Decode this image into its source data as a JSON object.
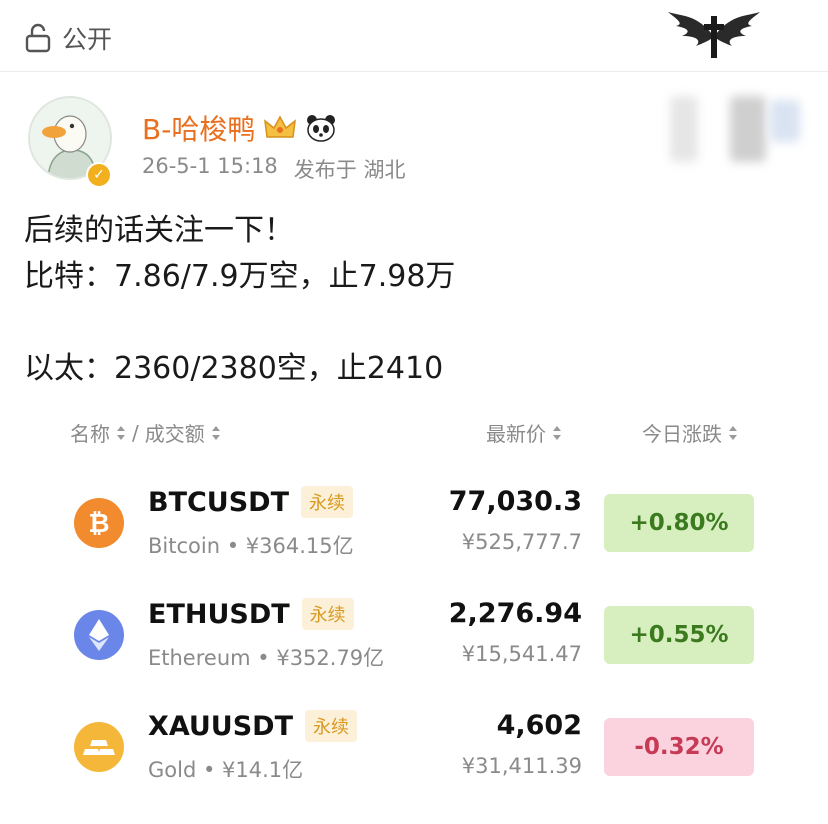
{
  "topbar": {
    "privacy_label": "公开"
  },
  "post": {
    "author": "B-哈梭鸭",
    "date": "26-5-1 15:18",
    "location": "发布于 湖北",
    "text": "后续的话关注一下！\n比特：7.86/7.9万空，止7.98万\n\n以太：2360/2380空，止2410"
  },
  "market": {
    "col_name": "名称",
    "col_separator": "/",
    "col_volume": "成交额",
    "col_price": "最新价",
    "col_change": "今日涨跌",
    "perp_label": "永续",
    "rows": [
      {
        "symbol": "BTCUSDT",
        "sub": "Bitcoin • ¥364.15亿",
        "price": "77,030.3",
        "cny": "¥525,777.7",
        "change": "+0.80%",
        "icon": "bitcoin-icon",
        "icon_color": "#f28a2e",
        "change_color": "#3b7a1f",
        "change_bg": "#d7efbf"
      },
      {
        "symbol": "ETHUSDT",
        "sub": "Ethereum • ¥352.79亿",
        "price": "2,276.94",
        "cny": "¥15,541.47",
        "change": "+0.55%",
        "icon": "ethereum-icon",
        "icon_color": "#6a86e8",
        "change_color": "#3b7a1f",
        "change_bg": "#d7efbf"
      },
      {
        "symbol": "XAUUSDT",
        "sub": "Gold • ¥14.1亿",
        "price": "4,602",
        "cny": "¥31,411.39",
        "change": "-0.32%",
        "icon": "gold-bars-icon",
        "icon_color": "#f4b73a",
        "change_color": "#c73a55",
        "change_bg": "#fbd3df"
      }
    ]
  },
  "colors": {
    "username": "#e8701f",
    "secondary_text": "#8a8a8a",
    "perp_tag_text": "#d89a23",
    "perp_tag_bg": "#fdf0d8"
  }
}
